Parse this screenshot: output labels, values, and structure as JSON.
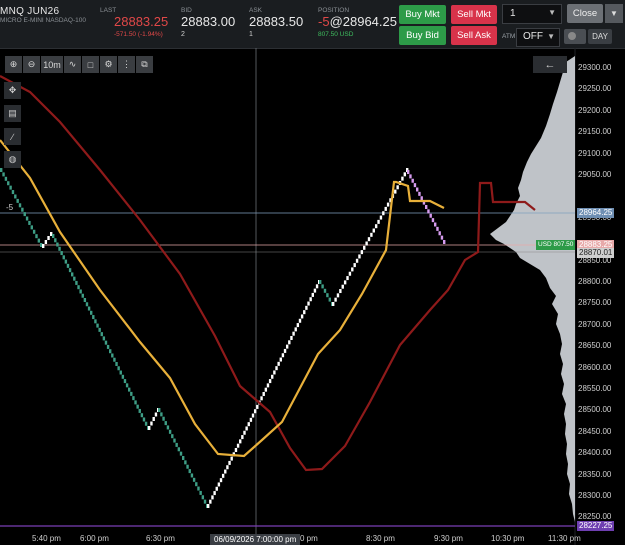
{
  "header": {
    "symbol": "MNQ JUN26",
    "symbol_desc": "MICRO E-MINI NASDAQ-100",
    "last": {
      "label": "LAST",
      "value": "28883.25",
      "change": "-571.50 (-1.94%)"
    },
    "bid": {
      "label": "BID",
      "value": "28883.00",
      "size": "2"
    },
    "ask": {
      "label": "ASK",
      "value": "28883.50",
      "size": "1"
    },
    "position": {
      "label": "POSITION",
      "qty": "-5",
      "price": "@28964.25",
      "pnl": "807.50 USD"
    },
    "buttons": {
      "buy_mkt": "Buy Mkt",
      "sell_mkt": "Sell Mkt",
      "buy_bid": "Buy Bid",
      "sell_ask": "Sell Ask"
    },
    "quantity": "1",
    "close": "Close",
    "atm_label": "ATM",
    "atm_value": "OFF",
    "day": "DAY"
  },
  "toolbar": {
    "timeframe": "10m"
  },
  "chart_data": {
    "type": "line",
    "price_axis": [
      "29300.00",
      "29250.00",
      "29200.00",
      "29150.00",
      "29100.00",
      "29050.00",
      "29000.00",
      "28950.00",
      "28900.00",
      "28850.00",
      "28800.00",
      "28750.00",
      "28700.00",
      "28650.00",
      "28600.00",
      "28550.00",
      "28500.00",
      "28450.00",
      "28400.00",
      "28350.00",
      "28300.00",
      "28250.00"
    ],
    "time_axis": [
      "5:40 pm",
      "6:00 pm",
      "6:30 pm",
      "0 pm",
      "8:30 pm",
      "9:30 pm",
      "10:30 pm",
      "11:30 pm"
    ],
    "crosshair_time": "06/09/2026 7:00:00 pm",
    "price_labels": {
      "position": "28964.25",
      "pnl": "USD 807.50",
      "last": "28883.25",
      "level": "28870.01",
      "bottom": "28227.25"
    },
    "position_marker": "-5",
    "colors": {
      "up": "#ffffff",
      "down": "#3e9e86",
      "down_recent": "#d79cf0",
      "fast_ma": "#e8b03a",
      "slow_ma": "#8e1a1a",
      "profile": "#c9ced3"
    }
  }
}
